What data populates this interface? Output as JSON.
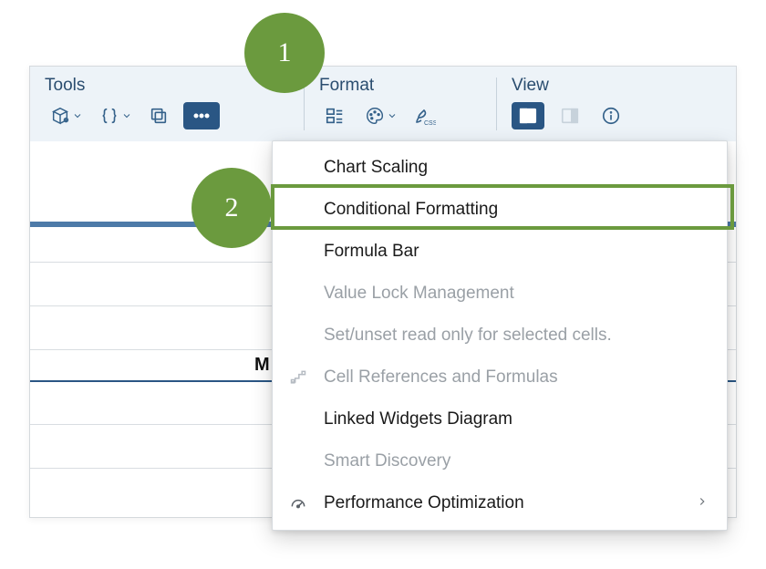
{
  "toolbar": {
    "sections": {
      "tools": {
        "title": "Tools"
      },
      "format": {
        "title": "Format"
      },
      "view": {
        "title": "View"
      }
    }
  },
  "content": {
    "letter_m": "M"
  },
  "dropdown": {
    "items": [
      {
        "label": "Chart Scaling",
        "disabled": false,
        "has_icon": false,
        "has_submenu": false
      },
      {
        "label": "Conditional Formatting",
        "disabled": false,
        "has_icon": false,
        "has_submenu": false
      },
      {
        "label": "Formula Bar",
        "disabled": false,
        "has_icon": false,
        "has_submenu": false
      },
      {
        "label": "Value Lock Management",
        "disabled": true,
        "has_icon": false,
        "has_submenu": false
      },
      {
        "label": "Set/unset read only for selected cells.",
        "disabled": true,
        "has_icon": false,
        "has_submenu": false
      },
      {
        "label": "Cell References and Formulas",
        "disabled": true,
        "has_icon": true,
        "icon": "steps",
        "has_submenu": false
      },
      {
        "label": "Linked Widgets Diagram",
        "disabled": false,
        "has_icon": false,
        "has_submenu": false
      },
      {
        "label": "Smart Discovery",
        "disabled": true,
        "has_icon": false,
        "has_submenu": false
      },
      {
        "label": "Performance Optimization",
        "disabled": false,
        "has_icon": true,
        "icon": "gauge",
        "has_submenu": true
      }
    ]
  },
  "callouts": {
    "one": "1",
    "two": "2"
  }
}
